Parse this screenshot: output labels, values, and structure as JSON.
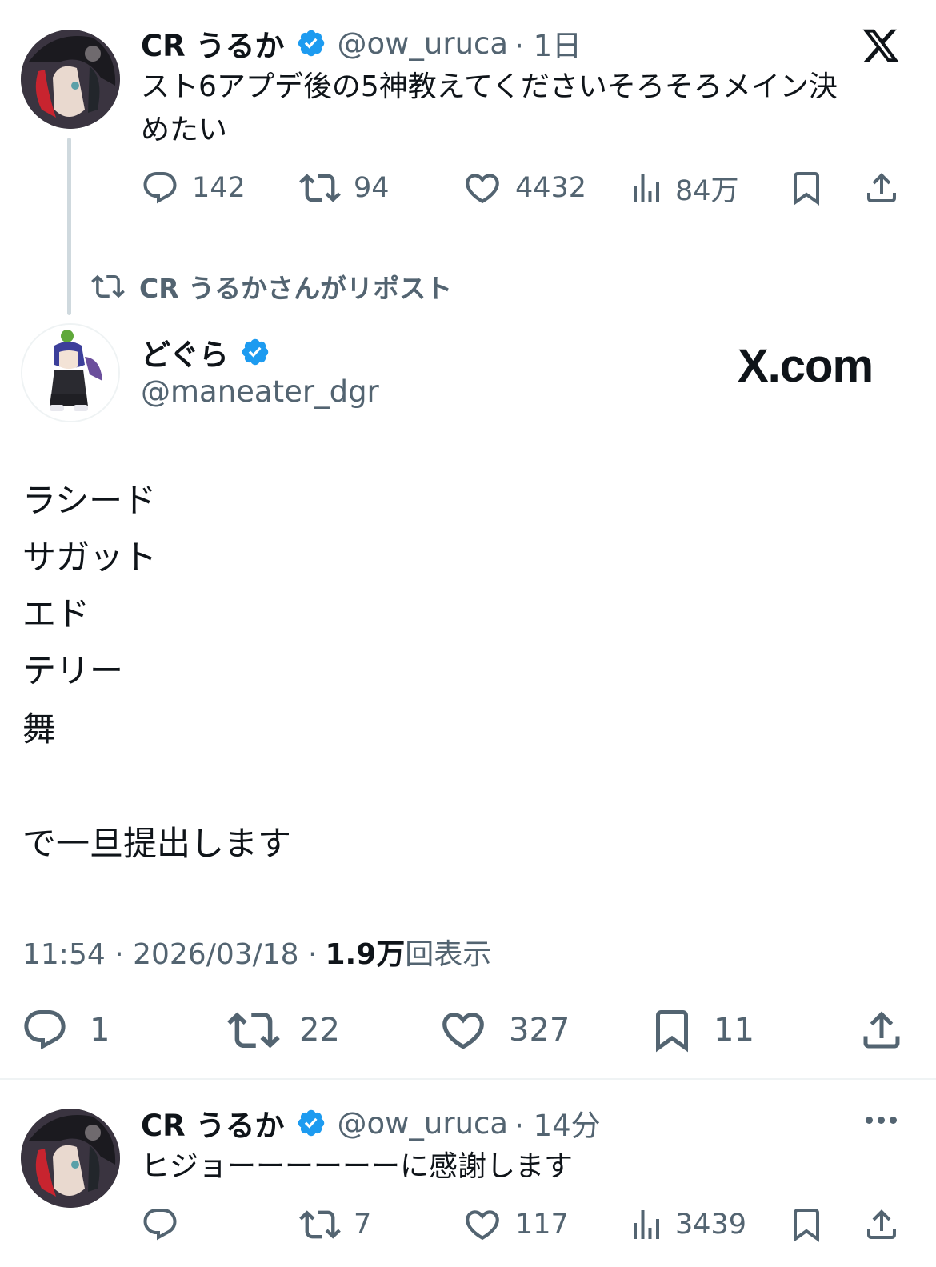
{
  "top_tweet": {
    "author_name": "CR うるか",
    "handle": "@ow_uruca",
    "time": "· 1日",
    "text_line1": "スト6アプデ後の5神教えてくださいそろそろメイン決",
    "text_line2": "めたい",
    "replies": "142",
    "reposts": "94",
    "likes": "4432",
    "views": "84万",
    "x_logo": "x-logo-icon"
  },
  "repost_label": "CR うるかさんがリポスト",
  "main_tweet": {
    "author_name": "どぐら",
    "handle": "@maneater_dgr",
    "watermark": "X.com",
    "body_lines": [
      "ラシード",
      "サガット",
      "エド",
      "テリー",
      "舞"
    ],
    "closing_line": "で一旦提出します",
    "timestamp": "11:54 · 2026/03/18 · ",
    "views_count": "1.9万",
    "views_suffix": "回表示",
    "replies": "1",
    "reposts": "22",
    "likes": "327",
    "bookmarks": "11"
  },
  "reply_tweet": {
    "author_name": "CR うるか",
    "handle": "@ow_uruca",
    "time": "· 14分",
    "text": "ヒジョーーーーーーに感謝します",
    "reposts": "7",
    "likes": "117",
    "views": "3439"
  },
  "colors": {
    "text": "#0f1419",
    "secondary": "#536471",
    "verified": "#1d9bf0",
    "thread_line": "#cfd9de"
  }
}
